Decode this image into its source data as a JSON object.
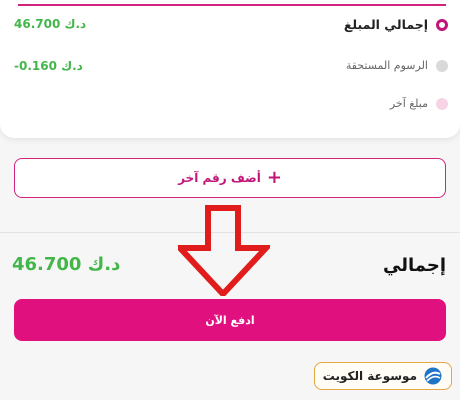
{
  "summary": {
    "items": [
      {
        "label": "إجمالي المبلغ",
        "amount": "46.700 د.ك",
        "state": "selected"
      },
      {
        "label": "الرسوم المستحقة",
        "amount": "-0.160 د.ك",
        "state": "unselected"
      },
      {
        "label": "مبلغ آخر",
        "amount": "",
        "state": "unselected"
      }
    ]
  },
  "add_number": {
    "label": "أضف رقم آخر",
    "icon": "plus-icon"
  },
  "total": {
    "label": "إجمالي",
    "value": "46.700 د.ك"
  },
  "pay": {
    "label": "ادفع الآن"
  },
  "watermark": {
    "text": "موسوعة الكويت"
  },
  "colors": {
    "accent": "#e0117f",
    "amount_green": "#43b649",
    "arrow_red": "#e11c1c",
    "badge_border": "#e6a640"
  }
}
